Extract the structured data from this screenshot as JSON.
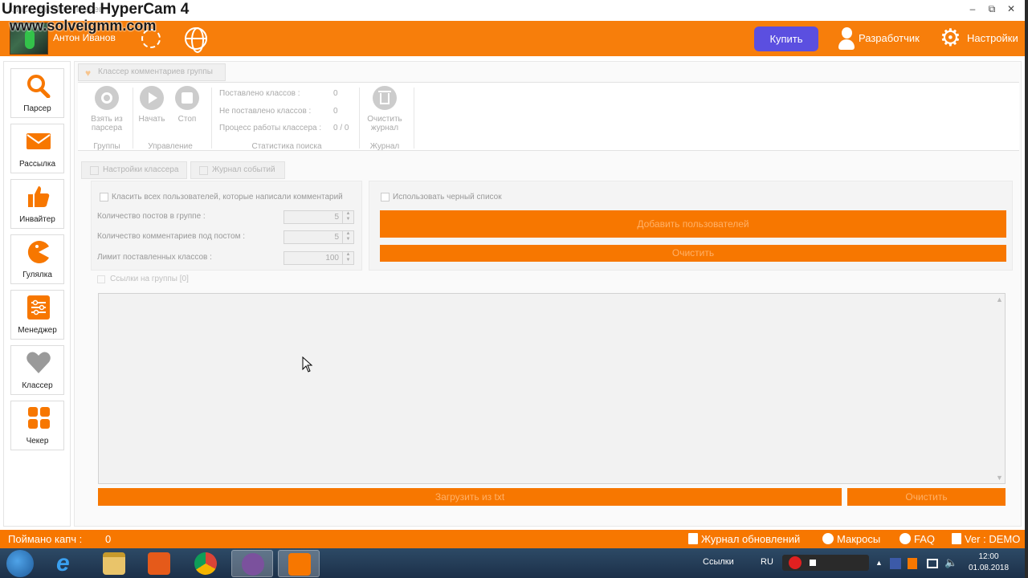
{
  "watermark": {
    "line1": "Unregistered HyperCam 4",
    "line2": "www.solveigmm.com"
  },
  "window": {
    "subtitle": "Классер комментариев",
    "controls": [
      "–",
      "⧉",
      "✕"
    ]
  },
  "header": {
    "username": "Антон Иванов",
    "buy_label": "Купить",
    "developer_label": "Разработчик",
    "settings_label": "Настройки"
  },
  "sidebar": {
    "items": [
      {
        "label": "Парсер",
        "icon": "search-icon"
      },
      {
        "label": "Рассылка",
        "icon": "mail-icon"
      },
      {
        "label": "Инвайтер",
        "icon": "thumbs-up-icon"
      },
      {
        "label": "Гулялка",
        "icon": "pacman-icon"
      },
      {
        "label": "Менеджер",
        "icon": "sliders-icon"
      },
      {
        "label": "Классер",
        "icon": "heart-icon"
      },
      {
        "label": "Чекер",
        "icon": "grid-icon"
      }
    ]
  },
  "main": {
    "tab_label": "Классер комментариев группы",
    "ribbon": {
      "take_from_parser": [
        "Взять из",
        "парсера"
      ],
      "start": "Начать",
      "stop": "Стоп",
      "clear_log": [
        "Очистить",
        "журнал"
      ],
      "groups": {
        "groups": "Группы",
        "control": "Управление",
        "stats": "Статистика поиска",
        "log": "Журнал"
      },
      "stats": [
        {
          "label": "Поставлено классов :",
          "value": "0"
        },
        {
          "label": "Не  поставлено классов :",
          "value": "0"
        },
        {
          "label": "Процесс работы классера :",
          "value": "0 / 0"
        }
      ]
    },
    "subtabs": {
      "settings": "Настройки классера",
      "log": "Журнал событий"
    },
    "settings": {
      "class_all_label": "Класить всех пользователей, которые написали комментарий",
      "posts_label": "Количество постов в группе :",
      "posts_value": "5",
      "comments_label": "Количество комментариев под постом :",
      "comments_value": "5",
      "limit_label": "Лимит поставленных классов :",
      "limit_value": "100"
    },
    "blacklist": {
      "use_label": "Использовать черный список",
      "add_users_label": "Добавить пользователей",
      "clear_label": "Очистить"
    },
    "links": {
      "title": "Ссылки на группы [0]",
      "load_label": "Загрузить из txt",
      "clear_label": "Очистить"
    }
  },
  "statusbar": {
    "captcha_label": "Поймано капч :",
    "captcha_value": "0",
    "updates_label": "Журнал обновлений",
    "macros_label": "Макросы",
    "faq_label": "FAQ",
    "version_label": "Ver : DEMO"
  },
  "taskbar": {
    "links_label": "Ссылки",
    "lang": "RU",
    "time": "12:00",
    "date": "01.08.2018"
  },
  "colors": {
    "accent": "#f77700",
    "buy": "#5b4fe0"
  }
}
